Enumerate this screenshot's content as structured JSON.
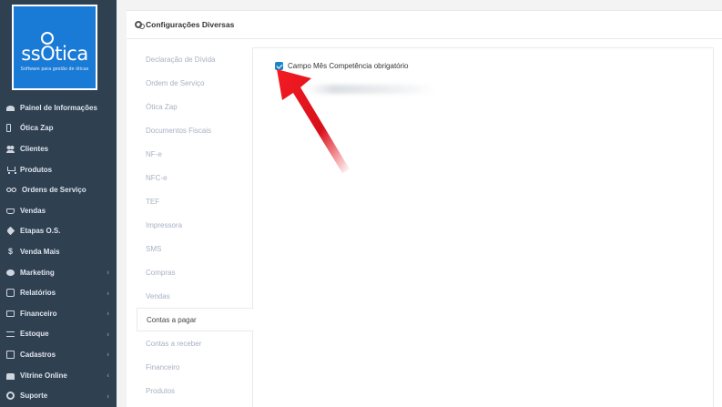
{
  "sidebar": {
    "logo": {
      "text": "ssOtica",
      "tagline": "Software para gestão de óticas"
    },
    "items": [
      {
        "label": "Painel de Informações",
        "icon": "dashboard-icon",
        "submenu": false
      },
      {
        "label": "Ótica Zap",
        "icon": "phone-icon",
        "submenu": false
      },
      {
        "label": "Clientes",
        "icon": "users-icon",
        "submenu": false
      },
      {
        "label": "Produtos",
        "icon": "cart-icon",
        "submenu": false
      },
      {
        "label": "Ordens de Serviço",
        "icon": "glasses-icon",
        "submenu": false
      },
      {
        "label": "Vendas",
        "icon": "basket-icon",
        "submenu": false
      },
      {
        "label": "Etapas O.S.",
        "icon": "tag-icon",
        "submenu": false
      },
      {
        "label": "Venda Mais",
        "icon": "dollar-icon",
        "submenu": false
      },
      {
        "label": "Marketing",
        "icon": "chat-icon",
        "submenu": true
      },
      {
        "label": "Relatórios",
        "icon": "report-icon",
        "submenu": true
      },
      {
        "label": "Financeiro",
        "icon": "money-icon",
        "submenu": true
      },
      {
        "label": "Estoque",
        "icon": "swap-icon",
        "submenu": true
      },
      {
        "label": "Cadastros",
        "icon": "edit-icon",
        "submenu": true
      },
      {
        "label": "Vitrine Online",
        "icon": "shop-icon",
        "submenu": true
      },
      {
        "label": "Suporte",
        "icon": "support-icon",
        "submenu": true
      }
    ],
    "chevron": "‹"
  },
  "panel": {
    "title": "Configurações Diversas"
  },
  "tabs": [
    {
      "label": "Declaração de Dívida",
      "active": false
    },
    {
      "label": "Ordem de Serviço",
      "active": false
    },
    {
      "label": "Ótica Zap",
      "active": false
    },
    {
      "label": "Documentos Fiscais",
      "active": false
    },
    {
      "label": "NF-e",
      "active": false
    },
    {
      "label": "NFC-e",
      "active": false
    },
    {
      "label": "TEF",
      "active": false
    },
    {
      "label": "Impressora",
      "active": false
    },
    {
      "label": "SMS",
      "active": false
    },
    {
      "label": "Compras",
      "active": false
    },
    {
      "label": "Vendas",
      "active": false
    },
    {
      "label": "Contas a pagar",
      "active": true
    },
    {
      "label": "Contas a receber",
      "active": false
    },
    {
      "label": "Financeiro",
      "active": false
    },
    {
      "label": "Produtos",
      "active": false
    }
  ],
  "content": {
    "checkbox_label": "Campo Mês Competência obrigatório",
    "checkbox_checked": true
  },
  "colors": {
    "sidebar_bg": "#2f4050",
    "logo_bg": "#1a7bd6",
    "checkbox": "#1c84c6",
    "arrow": "#e8141c"
  }
}
